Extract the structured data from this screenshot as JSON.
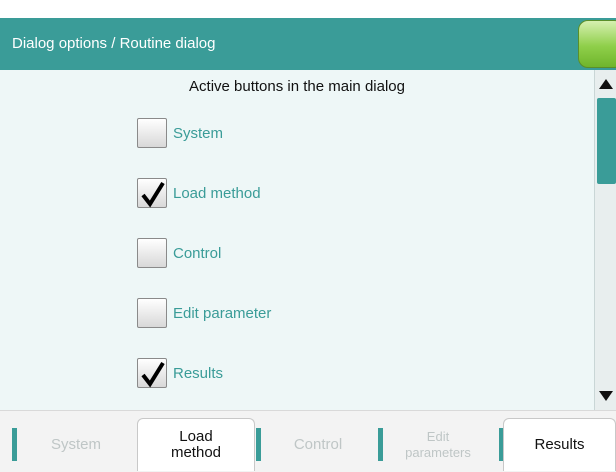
{
  "header": {
    "title": "Dialog options / Routine dialog"
  },
  "main": {
    "heading": "Active buttons in the main dialog",
    "options": [
      {
        "label": "System",
        "checked": false
      },
      {
        "label": "Load method",
        "checked": true
      },
      {
        "label": "Control",
        "checked": false
      },
      {
        "label": "Edit parameter",
        "checked": false
      },
      {
        "label": "Results",
        "checked": true
      }
    ]
  },
  "footer": {
    "buttons": [
      {
        "label": "System",
        "enabled": false
      },
      {
        "label": "Load\nmethod",
        "enabled": true
      },
      {
        "label": "Control",
        "enabled": false
      },
      {
        "label": "Edit\nparameters",
        "enabled": false
      },
      {
        "label": "Results",
        "enabled": true
      }
    ]
  },
  "colors": {
    "accent": "#3a9c98",
    "content_bg": "#eef7f7",
    "home_button": "#8fcf4a"
  }
}
